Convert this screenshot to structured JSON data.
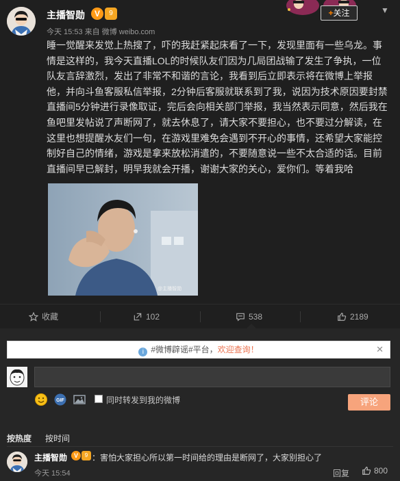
{
  "post": {
    "author": "主播智勋",
    "verified_icon": "V",
    "level_icon": "9",
    "meta": "今天 15:53 来自 微博 weibo.com",
    "follow_label": "关注",
    "follow_plus": "+",
    "more_icon": "chevron-down-icon",
    "text": "睡一觉醒来发觉上热搜了，吓的我赶紧起床看了一下，发现里面有一些乌龙。事情是这样的，我今天直播LOL的时候队友们因为几局团战输了发生了争执，一位队友言辞激烈，发出了非常不和谐的言论，我看到后立即表示将在微博上举报他，并向斗鱼客服私信举报，2分钟后客服就联系到了我，说因为技术原因要封禁直播间5分钟进行录像取证，完后会向相关部门举报，我当然表示同意，然后我在鱼吧里发帖说了声断网了，就去休息了，请大家不要担心，也不要过分解读，在这里也想提醒水友们一句，在游戏里难免会遇到不开心的事情，还希望大家能控制好自己的情绪，游戏是拿来放松消遣的，不要随意说一些不太合适的话。目前直播间早已解封，明早我就会开播，谢谢大家的关心，爱你们。等着我哈",
    "image_watermark": "@主播智勋"
  },
  "actions": {
    "favorite_label": "收藏",
    "repost_count": "102",
    "comment_count": "538",
    "like_count": "2189"
  },
  "notice": {
    "info_icon": "i",
    "text_prefix": "#微博辟谣#平台，",
    "text_highlight": "欢迎查询！",
    "close_icon": "✕"
  },
  "composer": {
    "input_value": "",
    "repost_label": "同时转发到我的微博",
    "submit_label": "评论"
  },
  "sort": {
    "hot_label": "按热度",
    "time_label": "按时间"
  },
  "comment": {
    "author": "主播智勋",
    "verified_icon": "V",
    "level_icon": "9",
    "text": "：害怕大家担心所以第一时间给的理由是断网了，大家别担心了",
    "time": "今天 15:54",
    "reply_label": "回复",
    "like_count": "800"
  },
  "colors": {
    "background": "#1f1f1f",
    "accent_orange": "#ff8200",
    "submit_button": "#f7a47c",
    "notice_highlight": "#eb7350"
  }
}
